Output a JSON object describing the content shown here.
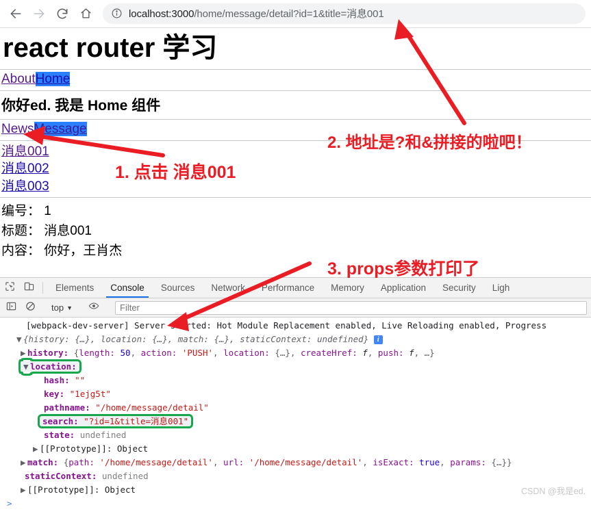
{
  "browser": {
    "back_icon": "arrow-left-icon",
    "forward_icon": "arrow-right-icon",
    "reload_icon": "reload-icon",
    "home_icon": "home-icon",
    "site_info_icon": "info-circle-icon",
    "url_host": "localhost:3000",
    "url_path": "/home/message/detail?id=1&title=消息001",
    "url_full": "localhost:3000/home/message/detail?id=1&title=消息001"
  },
  "page": {
    "title": "react router 学习",
    "top_nav": [
      {
        "label": "About",
        "state": "visited"
      },
      {
        "label": "Home",
        "state": "selected"
      }
    ],
    "greeting": "你好ed. 我是 Home 组件",
    "sub_nav": [
      {
        "label": "News",
        "state": "visited"
      },
      {
        "label": "Message",
        "state": "selected"
      }
    ],
    "messages": [
      {
        "label": "消息001",
        "state": "visited"
      },
      {
        "label": "消息002",
        "state": "unvisited"
      },
      {
        "label": "消息003",
        "state": "unvisited"
      }
    ],
    "detail": [
      {
        "key": "编号：",
        "value": "1"
      },
      {
        "key": "标题：",
        "value": "消息001"
      },
      {
        "key": "内容：",
        "value": "你好，王肖杰"
      }
    ]
  },
  "annotations": {
    "color": "#ea1c24",
    "items": [
      {
        "id": 1,
        "text": "1. 点击 消息001"
      },
      {
        "id": 2,
        "text": "2. 地址是?和&拼接的啦吧！"
      },
      {
        "id": 3,
        "text": "3. props参数打印了"
      }
    ]
  },
  "devtools": {
    "inspect_icon": "inspect-element-icon",
    "device_icon": "device-toolbar-icon",
    "tabs": [
      {
        "label": "Elements",
        "active": false
      },
      {
        "label": "Console",
        "active": true
      },
      {
        "label": "Sources",
        "active": false
      },
      {
        "label": "Network",
        "active": false
      },
      {
        "label": "Performance",
        "active": false
      },
      {
        "label": "Memory",
        "active": false
      },
      {
        "label": "Application",
        "active": false
      },
      {
        "label": "Security",
        "active": false
      },
      {
        "label": "Ligh",
        "active": false
      }
    ],
    "toolbar": {
      "sidebar_icon": "console-sidebar-icon",
      "clear_icon": "clear-console-icon",
      "context_label": "top",
      "context_caret": "▼",
      "eye_icon": "live-expression-eye-icon",
      "filter_placeholder": "Filter"
    },
    "console": {
      "system_message": "[webpack-dev-server] Server started: Hot Module Replacement enabled, Live Reloading enabled, Progress",
      "root_preview": "{history: {…}, location: {…}, match: {…}, staticContext: undefined}",
      "history_key": "history:",
      "history_len_key": "length:",
      "history_len_val": "50",
      "history_action_key": "action:",
      "history_action_val": "'PUSH'",
      "history_location_key": "location:",
      "history_location_val": "{…}",
      "history_createhref_key": "createHref:",
      "history_createhref_val": "f",
      "history_push_key": "push:",
      "history_push_val": "f",
      "history_more": "…}",
      "location_key": "location:",
      "hash_key": "hash:",
      "hash_val": "\"\"",
      "key_key": "key:",
      "key_val": "\"1ejg5t\"",
      "pathname_key": "pathname:",
      "pathname_val": "\"/home/message/detail\"",
      "search_key": "search:",
      "search_val": "\"?id=1&title=消息001\"",
      "state_key": "state:",
      "state_val": "undefined",
      "proto_label": "[[Prototype]]:",
      "proto_val": "Object",
      "match_key": "match:",
      "match_path_key": "path:",
      "match_path_val": "'/home/message/detail'",
      "match_url_key": "url:",
      "match_url_val": "'/home/message/detail'",
      "match_isexact_key": "isExact:",
      "match_isexact_val": "true",
      "match_params_key": "params:",
      "match_params_val": "{…}}",
      "static_key": "staticContext:",
      "static_val": "undefined",
      "prompt": ">"
    },
    "watermark": "CSDN @我是ed.",
    "highlight_color": "#16a84a"
  }
}
